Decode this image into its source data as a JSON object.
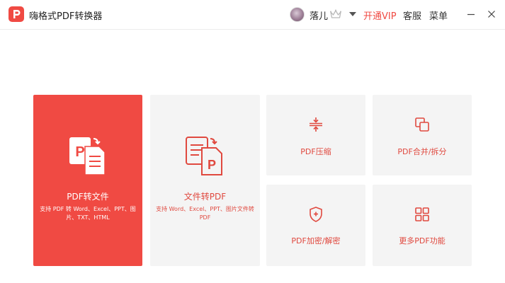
{
  "app": {
    "title": "嗨格式PDF转换器",
    "logo_icon": "app-logo-icon"
  },
  "header": {
    "username": "落儿",
    "vip_label": "开通VIP",
    "service_label": "客服",
    "menu_label": "菜单",
    "accent_color": "#f04a43"
  },
  "main": {
    "cards": [
      {
        "title": "PDF转文件",
        "description": "支持 PDF 转 Word、Excel、PPT、图片、TXT、HTML",
        "icon": "pdf-to-file-icon"
      },
      {
        "title": "文件转PDF",
        "description": "支持 Word、Excel、PPT、图片文件转 PDF",
        "icon": "file-to-pdf-icon"
      },
      {
        "title": "PDF压缩",
        "icon": "compress-icon"
      },
      {
        "title": "PDF合并/拆分",
        "icon": "merge-split-icon"
      },
      {
        "title": "PDF加密/解密",
        "icon": "shield-icon"
      },
      {
        "title": "更多PDF功能",
        "icon": "grid-icon"
      }
    ]
  }
}
